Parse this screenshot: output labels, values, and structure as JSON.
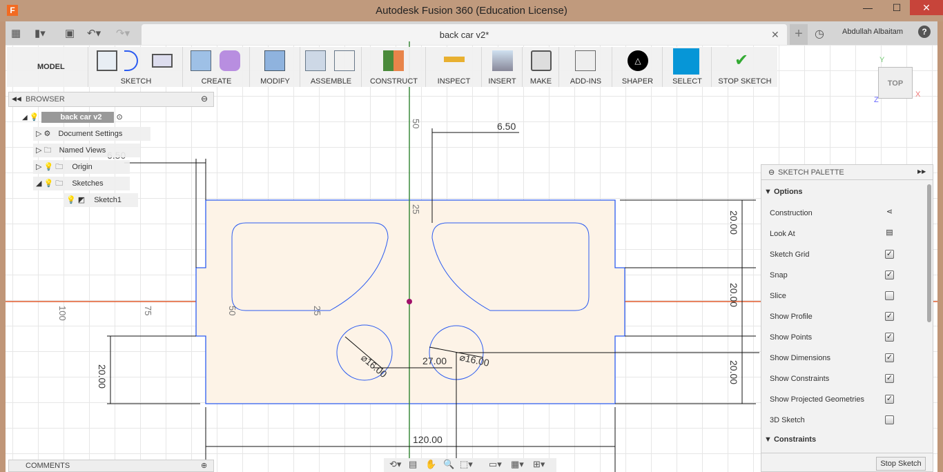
{
  "window": {
    "title": "Autodesk Fusion 360 (Education License)",
    "logo": "F",
    "controls": [
      "minimize",
      "maximize",
      "close"
    ]
  },
  "tabbar": {
    "doc_tab": "back car v2*",
    "user": "Abdullah Albaitam",
    "icons": [
      "grid-icon",
      "file-icon",
      "save-icon",
      "undo-icon",
      "redo-icon",
      "plus-icon",
      "clock-icon",
      "help-icon"
    ]
  },
  "toolbar": {
    "workspace": "MODEL",
    "groups": [
      "SKETCH",
      "CREATE",
      "MODIFY",
      "ASSEMBLE",
      "CONSTRUCT",
      "INSPECT",
      "INSERT",
      "MAKE",
      "ADD-INS",
      "SHAPER",
      "SELECT",
      "STOP SKETCH"
    ],
    "accent": "#0696d7"
  },
  "browser": {
    "title": "BROWSER",
    "root": "back car v2",
    "items": [
      "Document Settings",
      "Named Views",
      "Origin",
      "Sketches",
      "Sketch1"
    ]
  },
  "comments": {
    "title": "COMMENTS"
  },
  "viewcube": {
    "face": "TOP",
    "axes": [
      "Y",
      "Z",
      "X"
    ]
  },
  "palette": {
    "title": "SKETCH PALETTE",
    "options_header": "Options",
    "constraints_header": "Constraints",
    "stop_button": "Stop Sketch",
    "options": [
      {
        "label": "Construction",
        "type": "icon",
        "icon": "construction-icon"
      },
      {
        "label": "Look At",
        "type": "icon",
        "icon": "look-at-icon"
      },
      {
        "label": "Sketch Grid",
        "checked": true
      },
      {
        "label": "Snap",
        "checked": true
      },
      {
        "label": "Slice",
        "checked": false
      },
      {
        "label": "Show Profile",
        "checked": true
      },
      {
        "label": "Show Points",
        "checked": true
      },
      {
        "label": "Show Dimensions",
        "checked": true
      },
      {
        "label": "Show Constraints",
        "checked": true
      },
      {
        "label": "Show Projected Geometries",
        "checked": true
      },
      {
        "label": "3D Sketch",
        "checked": false
      }
    ]
  },
  "sketch": {
    "dimensions": {
      "top": "6.50",
      "top_left": "6.50",
      "right_top": "20.00",
      "right_mid": "20.00",
      "right_bottom": "20.00",
      "left": "20.00",
      "width": "120.00",
      "offset": "27.00",
      "dia_right": "⌀16.00",
      "dia_left": "⌀16.00"
    },
    "grid_labels": [
      "100",
      "75",
      "50",
      "25",
      "50",
      "25"
    ],
    "colors": {
      "profile": "#fdf3e7",
      "line": "#2b5bf0",
      "x_axis": "#e05a2b",
      "y_axis": "#3a8a3a"
    }
  }
}
